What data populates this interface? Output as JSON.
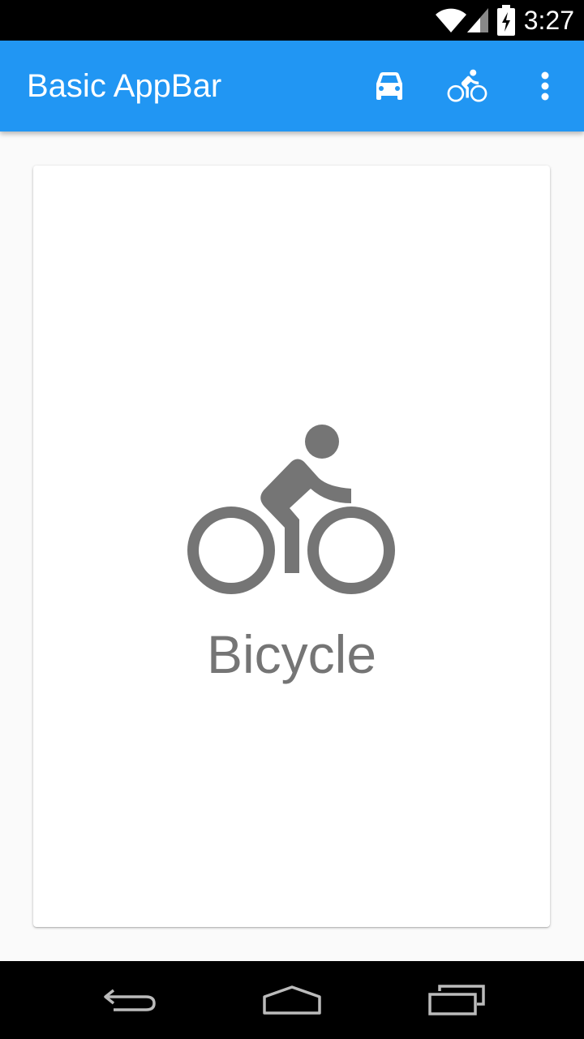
{
  "status_bar": {
    "time": "3:27",
    "icons": [
      "wifi-icon",
      "cell-signal-icon",
      "battery-charging-icon"
    ]
  },
  "app_bar": {
    "title": "Basic AppBar",
    "background_color": "#2196f3",
    "actions": [
      {
        "icon": "car-icon"
      },
      {
        "icon": "bicycle-icon"
      },
      {
        "icon": "more-vert-icon"
      }
    ]
  },
  "card": {
    "icon": "bicycle-icon",
    "label": "Bicycle",
    "icon_color": "#757575"
  },
  "nav_bar": {
    "buttons": [
      "back-icon",
      "home-icon",
      "recents-icon"
    ]
  }
}
